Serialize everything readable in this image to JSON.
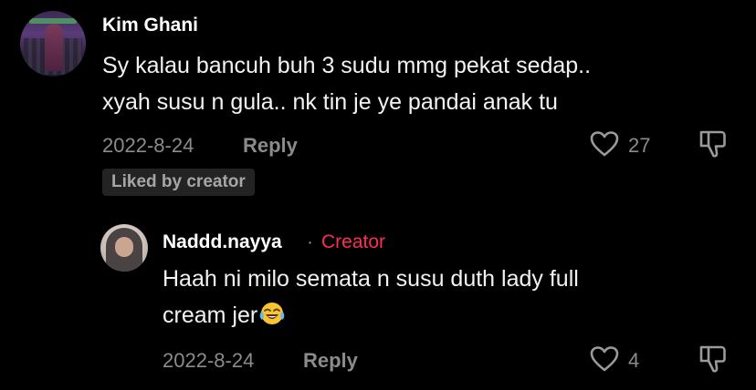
{
  "comments": [
    {
      "username": "Kim Ghani",
      "text_line1": "Sy kalau bancuh buh 3 sudu mmg pekat sedap..",
      "text_line2": "xyah susu n gula.. nk tin je ye pandai anak tu",
      "date": "2022-8-24",
      "reply_label": "Reply",
      "like_count": "27",
      "badge": "Liked by creator",
      "like_icon": "heart-outline",
      "dislike_icon": "thumbs-down"
    },
    {
      "username": "Naddd.nayya",
      "separator": "·",
      "creator_label": "Creator",
      "text_line1": "Haah ni milo semata n susu duth lady full",
      "text_line2": "cream jer",
      "emoji": "face-with-tears-of-joy",
      "date": "2022-8-24",
      "reply_label": "Reply",
      "like_count": "4",
      "like_icon": "heart-outline",
      "dislike_icon": "thumbs-down"
    }
  ],
  "colors": {
    "background": "#000000",
    "creator_accent": "#fe2c55",
    "muted_text": "#8b8b8b"
  }
}
